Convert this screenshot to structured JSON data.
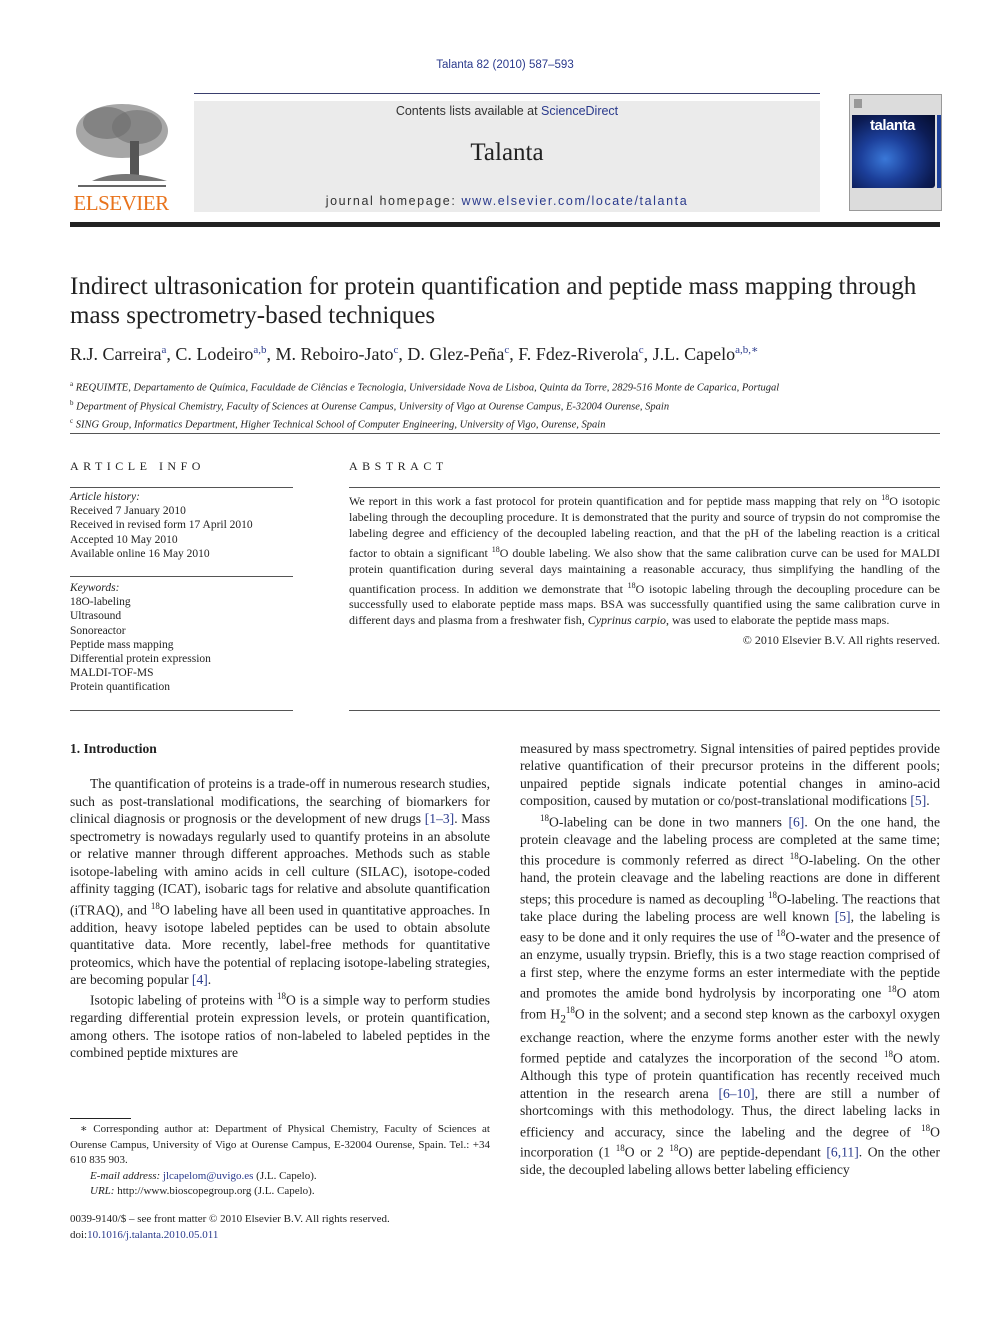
{
  "header": {
    "citation": "Talanta 82 (2010) 587–593",
    "contents_prefix": "Contents lists available at ",
    "contents_link": "ScienceDirect",
    "journal": "Talanta",
    "homepage_prefix": "journal homepage: ",
    "homepage_link": "www.elsevier.com/locate/talanta",
    "publisher_logo": "ELSEVIER",
    "cover_title": "talanta"
  },
  "article": {
    "title": "Indirect ultrasonication for protein quantification and peptide mass mapping through mass spectrometry-based techniques",
    "authors": [
      {
        "name": "R.J. Carreira",
        "aff": "a"
      },
      {
        "name": "C. Lodeiro",
        "aff": "a,b"
      },
      {
        "name": "M. Reboiro-Jato",
        "aff": "c"
      },
      {
        "name": "D. Glez-Peña",
        "aff": "c"
      },
      {
        "name": "F. Fdez-Riverola",
        "aff": "c"
      },
      {
        "name": "J.L. Capelo",
        "aff": "a,b,∗"
      }
    ],
    "affiliations": [
      {
        "mark": "a",
        "text": "REQUIMTE, Departamento de Química, Faculdade de Ciências e Tecnologia, Universidade Nova de Lisboa, Quinta da Torre, 2829-516 Monte de Caparica, Portugal"
      },
      {
        "mark": "b",
        "text": "Department of Physical Chemistry, Faculty of Sciences at Ourense Campus, University of Vigo at Ourense Campus, E-32004 Ourense, Spain"
      },
      {
        "mark": "c",
        "text": "SING Group, Informatics Department, Higher Technical School of Computer Engineering, University of Vigo, Ourense, Spain"
      }
    ]
  },
  "article_info": {
    "heading": "ARTICLE INFO",
    "history_label": "Article history:",
    "history": [
      "Received 7 January 2010",
      "Received in revised form 17 April 2010",
      "Accepted 10 May 2010",
      "Available online 16 May 2010"
    ],
    "keywords_label": "Keywords:",
    "keywords": [
      "18O-labeling",
      "Ultrasound",
      "Sonoreactor",
      "Peptide mass mapping",
      "Differential protein expression",
      "MALDI-TOF-MS",
      "Protein quantification"
    ]
  },
  "abstract": {
    "heading": "ABSTRACT",
    "p1": "We report in this work a fast protocol for protein quantification and for peptide mass mapping that rely on ",
    "p2": "O isotopic labeling through the decoupling procedure. It is demonstrated that the purity and source of trypsin do not compromise the labeling degree and efficiency of the decoupled labeling reaction, and that the pH of the labeling reaction is a critical factor to obtain a significant ",
    "p3": "O double labeling. We also show that the same calibration curve can be used for MALDI protein quantification during several days maintaining a reasonable accuracy, thus simplifying the handling of the quantification process. In addition we demonstrate that ",
    "p4": "O isotopic labeling through the decoupling procedure can be successfully used to elaborate peptide mass maps. BSA was successfully quantified using the same calibration curve in different days and plasma from a freshwater fish, ",
    "species": "Cyprinus carpio",
    "p5": ", was used to elaborate the peptide mass maps.",
    "iso": "18",
    "copyright": "© 2010 Elsevier B.V. All rights reserved."
  },
  "intro": {
    "heading": "1.  Introduction",
    "c1": {
      "a": "The quantification of proteins is a trade-off in numerous research studies, such as post-translational modifications, the searching of biomarkers for clinical diagnosis or prognosis or the development of new drugs ",
      "ref1": "[1–3]",
      "b": ". Mass spectrometry is nowadays regularly used to quantify proteins in an absolute or relative manner through different approaches. Methods such as stable isotope-labeling with amino acids in cell culture (SILAC), isotope-coded affinity tagging (ICAT), isobaric tags for relative and absolute quantification (iTRAQ), and ",
      "c": "O labeling have all been used in quantitative approaches. In addition, heavy isotope labeled peptides can be used to obtain absolute quantitative data. More recently, label-free methods for quantitative proteomics, which have the potential of replacing isotope-labeling strategies, are becoming popular ",
      "ref2": "[4]",
      "d": ".",
      "p2a": "Isotopic labeling of proteins with ",
      "p2b": "O is a simple way to perform studies regarding differential protein expression levels, or protein quantification, among others. The isotope ratios of non-labeled to labeled peptides in the combined peptide mixtures are"
    },
    "c2": {
      "a": "measured by mass spectrometry. Signal intensities of paired peptides provide relative quantification of their precursor proteins in the different pools; unpaired peptide signals indicate potential changes in amino-acid composition, caused by mutation or co/post-translational modifications ",
      "ref5": "[5]",
      "b": ".",
      "p2a": "O-labeling can be done in two manners ",
      "ref6": "[6]",
      "p2b": ". On the one hand, the protein cleavage and the labeling process are completed at the same time; this procedure is commonly referred as direct ",
      "p2c": "O-labeling. On the other hand, the protein cleavage and the labeling reactions are done in different steps; this procedure is named as decoupling ",
      "p2d": "O-labeling. The reactions that take place during the labeling process are well known ",
      "ref5b": "[5]",
      "p2e": ", the labeling is easy to be done and it only requires the use of ",
      "p2f": "O-water and the presence of an enzyme, usually trypsin. Briefly, this is a two stage reaction comprised of a first step, where the enzyme forms an ester intermediate with the peptide and promotes the amide bond hydrolysis by incorporating one ",
      "p2g": "O atom from H",
      "sub2": "2",
      "p2h": "O in the solvent; and a second step known as the carboxyl oxygen exchange reaction, where the enzyme forms another ester with the newly formed peptide and catalyzes the incorporation of the second ",
      "p2i": "O atom. Although this type of protein quantification has recently received much attention in the research arena ",
      "ref610": "[6–10]",
      "p2j": ", there are still a number of shortcomings with this methodology. Thus, the direct labeling lacks in efficiency and accuracy, since the labeling and the degree of ",
      "p2k": "O incorporation (1 ",
      "p2l": "O or 2 ",
      "p2m": "O) are peptide-dependant ",
      "ref611": "[6,11]",
      "p2n": ". On the other side, the decoupled labeling allows better labeling efficiency"
    }
  },
  "footnote": {
    "star": "∗",
    "corresponding": " Corresponding author at: Department of Physical Chemistry, Faculty of Sciences at Ourense Campus, University of Vigo at Ourense Campus, E-32004 Ourense, Spain. Tel.: +34 610 835 903.",
    "email_label": "E-mail address:",
    "email": "jlcapelom@uvigo.es",
    "email_owner": " (J.L. Capelo).",
    "url_label": "URL:",
    "url": " http://www.bioscopegroup.org (J.L. Capelo).",
    "front_matter": "0039-9140/$ – see front matter © 2010 Elsevier B.V. All rights reserved.",
    "doi_label": "doi:",
    "doi": "10.1016/j.talanta.2010.05.011"
  }
}
